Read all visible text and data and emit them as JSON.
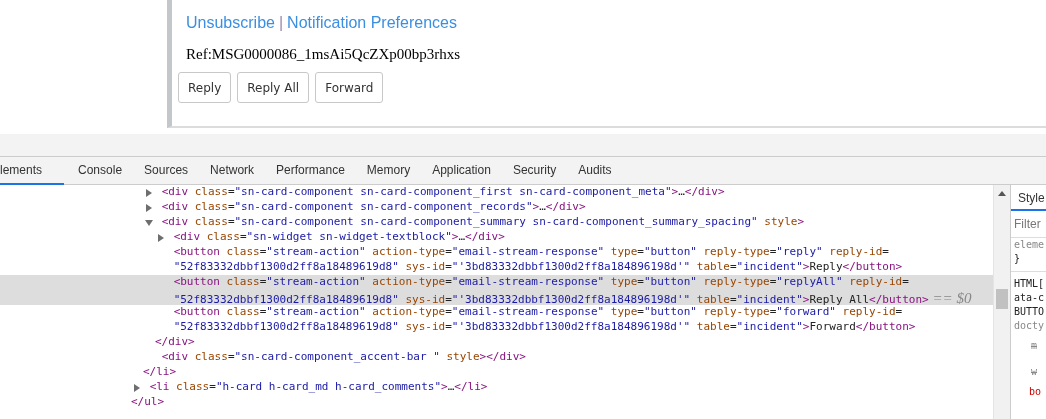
{
  "page": {
    "links": [
      {
        "label": "Unsubscribe"
      },
      {
        "label": "Notification Preferences"
      }
    ],
    "separator": "|",
    "reference": "Ref:MSG0000086_1msAi5QcZXp00bp3rhxs",
    "buttons": [
      "Reply",
      "Reply All",
      "Forward"
    ]
  },
  "devtools": {
    "tabs": [
      {
        "label": "lements",
        "selected": true
      },
      {
        "label": "Console",
        "selected": false
      },
      {
        "label": "Sources",
        "selected": false
      },
      {
        "label": "Network",
        "selected": false
      },
      {
        "label": "Performance",
        "selected": false
      },
      {
        "label": "Memory",
        "selected": false
      },
      {
        "label": "Application",
        "selected": false
      },
      {
        "label": "Security",
        "selected": false
      },
      {
        "label": "Audits",
        "selected": false
      }
    ],
    "dom_tree": [
      {
        "selected": false,
        "close": [
          {
            "kind": "tag",
            "text": "</ul>"
          }
        ],
        "children": [
          {
            "selected": false,
            "close": [
              {
                "kind": "tag",
                "text": "</li>"
              }
            ],
            "children": [
              {
                "expanded": false,
                "selected": false,
                "lines": [
                  [
                    {
                      "kind": "tag",
                      "text": "<div"
                    },
                    {
                      "kind": "attr",
                      "text": " class"
                    },
                    {
                      "kind": "punct",
                      "text": "="
                    },
                    {
                      "kind": "val",
                      "text": "\"sn-card-component sn-card-component_first sn-card-component_meta\""
                    },
                    {
                      "kind": "tag",
                      "text": ">"
                    },
                    {
                      "kind": "text",
                      "text": "…"
                    },
                    {
                      "kind": "tag",
                      "text": "</div>"
                    }
                  ]
                ]
              },
              {
                "expanded": false,
                "selected": false,
                "lines": [
                  [
                    {
                      "kind": "tag",
                      "text": "<div"
                    },
                    {
                      "kind": "attr",
                      "text": " class"
                    },
                    {
                      "kind": "punct",
                      "text": "="
                    },
                    {
                      "kind": "val",
                      "text": "\"sn-card-component sn-card-component_records\""
                    },
                    {
                      "kind": "tag",
                      "text": ">"
                    },
                    {
                      "kind": "text",
                      "text": "…"
                    },
                    {
                      "kind": "tag",
                      "text": "</div>"
                    }
                  ]
                ]
              },
              {
                "expanded": true,
                "selected": false,
                "lines": [
                  [
                    {
                      "kind": "tag",
                      "text": "<div"
                    },
                    {
                      "kind": "attr",
                      "text": " class"
                    },
                    {
                      "kind": "punct",
                      "text": "="
                    },
                    {
                      "kind": "val",
                      "text": "\"sn-card-component sn-card-component_summary sn-card-component_summary_spacing\""
                    },
                    {
                      "kind": "attr",
                      "text": " style"
                    },
                    {
                      "kind": "tag",
                      "text": ">"
                    }
                  ]
                ],
                "close": [
                  {
                    "kind": "tag",
                    "text": "</div>"
                  }
                ],
                "children": [
                  {
                    "expanded": false,
                    "selected": false,
                    "lines": [
                      [
                        {
                          "kind": "tag",
                          "text": "<div"
                        },
                        {
                          "kind": "attr",
                          "text": " class"
                        },
                        {
                          "kind": "punct",
                          "text": "="
                        },
                        {
                          "kind": "val",
                          "text": "\"sn-widget sn-widget-textblock\""
                        },
                        {
                          "kind": "tag",
                          "text": ">"
                        },
                        {
                          "kind": "text",
                          "text": "…"
                        },
                        {
                          "kind": "tag",
                          "text": "</div>"
                        }
                      ]
                    ]
                  },
                  {
                    "selected": false,
                    "lines": [
                      [
                        {
                          "kind": "tag",
                          "text": "<button"
                        },
                        {
                          "kind": "attr",
                          "text": " class"
                        },
                        {
                          "kind": "punct",
                          "text": "="
                        },
                        {
                          "kind": "val",
                          "text": "\"stream-action\""
                        },
                        {
                          "kind": "attr",
                          "text": " action-type"
                        },
                        {
                          "kind": "punct",
                          "text": "="
                        },
                        {
                          "kind": "val",
                          "text": "\"email-stream-response\""
                        },
                        {
                          "kind": "attr",
                          "text": " type"
                        },
                        {
                          "kind": "punct",
                          "text": "="
                        },
                        {
                          "kind": "val",
                          "text": "\"button\""
                        },
                        {
                          "kind": "attr",
                          "text": " reply-type"
                        },
                        {
                          "kind": "punct",
                          "text": "="
                        },
                        {
                          "kind": "val",
                          "text": "\"reply\""
                        },
                        {
                          "kind": "attr",
                          "text": " reply-id"
                        },
                        {
                          "kind": "punct",
                          "text": "="
                        }
                      ],
                      [
                        {
                          "kind": "val",
                          "text": "\"52f83332dbbf1300d2ff8a18489619d8\""
                        },
                        {
                          "kind": "attr",
                          "text": " sys-id"
                        },
                        {
                          "kind": "punct",
                          "text": "="
                        },
                        {
                          "kind": "val",
                          "text": "\"'3bd83332dbbf1300d2ff8a184896198d'\""
                        },
                        {
                          "kind": "attr",
                          "text": " table"
                        },
                        {
                          "kind": "punct",
                          "text": "="
                        },
                        {
                          "kind": "val",
                          "text": "\"incident\""
                        },
                        {
                          "kind": "tag",
                          "text": ">"
                        },
                        {
                          "kind": "text",
                          "text": "Reply"
                        },
                        {
                          "kind": "tag",
                          "text": "</button>"
                        }
                      ]
                    ]
                  },
                  {
                    "selected": true,
                    "lines": [
                      [
                        {
                          "kind": "tag",
                          "text": "<button"
                        },
                        {
                          "kind": "attr",
                          "text": " class"
                        },
                        {
                          "kind": "punct",
                          "text": "="
                        },
                        {
                          "kind": "val",
                          "text": "\"stream-action\""
                        },
                        {
                          "kind": "attr",
                          "text": " action-type"
                        },
                        {
                          "kind": "punct",
                          "text": "="
                        },
                        {
                          "kind": "val",
                          "text": "\"email-stream-response\""
                        },
                        {
                          "kind": "attr",
                          "text": " type"
                        },
                        {
                          "kind": "punct",
                          "text": "="
                        },
                        {
                          "kind": "val",
                          "text": "\"button\""
                        },
                        {
                          "kind": "attr",
                          "text": " reply-type"
                        },
                        {
                          "kind": "punct",
                          "text": "="
                        },
                        {
                          "kind": "val",
                          "text": "\"replyAll\""
                        },
                        {
                          "kind": "attr",
                          "text": " reply-id"
                        },
                        {
                          "kind": "punct",
                          "text": "="
                        }
                      ],
                      [
                        {
                          "kind": "val",
                          "text": "\"52f83332dbbf1300d2ff8a18489619d8\""
                        },
                        {
                          "kind": "attr",
                          "text": " sys-id"
                        },
                        {
                          "kind": "punct",
                          "text": "="
                        },
                        {
                          "kind": "val",
                          "text": "\"'3bd83332dbbf1300d2ff8a184896198d'\""
                        },
                        {
                          "kind": "attr",
                          "text": " table"
                        },
                        {
                          "kind": "punct",
                          "text": "="
                        },
                        {
                          "kind": "val",
                          "text": "\"incident\""
                        },
                        {
                          "kind": "tag",
                          "text": ">"
                        },
                        {
                          "kind": "text",
                          "text": "Reply All"
                        },
                        {
                          "kind": "tag",
                          "text": "</button>"
                        },
                        {
                          "kind": "ref",
                          "text": " == $0"
                        }
                      ]
                    ]
                  },
                  {
                    "selected": false,
                    "lines": [
                      [
                        {
                          "kind": "tag",
                          "text": "<button"
                        },
                        {
                          "kind": "attr",
                          "text": " class"
                        },
                        {
                          "kind": "punct",
                          "text": "="
                        },
                        {
                          "kind": "val",
                          "text": "\"stream-action\""
                        },
                        {
                          "kind": "attr",
                          "text": " action-type"
                        },
                        {
                          "kind": "punct",
                          "text": "="
                        },
                        {
                          "kind": "val",
                          "text": "\"email-stream-response\""
                        },
                        {
                          "kind": "attr",
                          "text": " type"
                        },
                        {
                          "kind": "punct",
                          "text": "="
                        },
                        {
                          "kind": "val",
                          "text": "\"button\""
                        },
                        {
                          "kind": "attr",
                          "text": " reply-type"
                        },
                        {
                          "kind": "punct",
                          "text": "="
                        },
                        {
                          "kind": "val",
                          "text": "\"forward\""
                        },
                        {
                          "kind": "attr",
                          "text": " reply-id"
                        },
                        {
                          "kind": "punct",
                          "text": "="
                        }
                      ],
                      [
                        {
                          "kind": "val",
                          "text": "\"52f83332dbbf1300d2ff8a18489619d8\""
                        },
                        {
                          "kind": "attr",
                          "text": " sys-id"
                        },
                        {
                          "kind": "punct",
                          "text": "="
                        },
                        {
                          "kind": "val",
                          "text": "\"'3bd83332dbbf1300d2ff8a184896198d'\""
                        },
                        {
                          "kind": "attr",
                          "text": " table"
                        },
                        {
                          "kind": "punct",
                          "text": "="
                        },
                        {
                          "kind": "val",
                          "text": "\"incident\""
                        },
                        {
                          "kind": "tag",
                          "text": ">"
                        },
                        {
                          "kind": "text",
                          "text": "Forward"
                        },
                        {
                          "kind": "tag",
                          "text": "</button>"
                        }
                      ]
                    ]
                  }
                ]
              },
              {
                "selected": false,
                "lines": [
                  [
                    {
                      "kind": "tag",
                      "text": "<div"
                    },
                    {
                      "kind": "attr",
                      "text": " class"
                    },
                    {
                      "kind": "punct",
                      "text": "="
                    },
                    {
                      "kind": "val",
                      "text": "\"sn-card-component_accent-bar \""
                    },
                    {
                      "kind": "attr",
                      "text": " style"
                    },
                    {
                      "kind": "tag",
                      "text": ">"
                    },
                    {
                      "kind": "tag",
                      "text": "</div>"
                    }
                  ]
                ]
              }
            ]
          },
          {
            "expanded": false,
            "selected": false,
            "lines": [
              [
                {
                  "kind": "tag",
                  "text": "<li"
                },
                {
                  "kind": "attr",
                  "text": " class"
                },
                {
                  "kind": "punct",
                  "text": "="
                },
                {
                  "kind": "val",
                  "text": "\"h-card h-card_md h-card_comments\""
                },
                {
                  "kind": "tag",
                  "text": ">"
                },
                {
                  "kind": "text",
                  "text": "…"
                },
                {
                  "kind": "tag",
                  "text": "</li>"
                }
              ]
            ]
          }
        ]
      }
    ],
    "styles_pane": {
      "tab": "Style",
      "filter_placeholder": "Filter",
      "rules": [
        {
          "kind": "muted",
          "text": "eleme"
        },
        {
          "kind": "plain",
          "text": "}"
        },
        {
          "kind": "divider"
        },
        {
          "kind": "plain",
          "text": "HTML["
        },
        {
          "kind": "plain",
          "text": "ata-c"
        },
        {
          "kind": "plain",
          "text": "BUTTO"
        },
        {
          "kind": "muted",
          "text": "docty"
        },
        {
          "kind": "struck",
          "text": "m"
        },
        {
          "kind": "struck",
          "text": "w"
        },
        {
          "kind": "property",
          "text": "bo"
        }
      ]
    }
  }
}
